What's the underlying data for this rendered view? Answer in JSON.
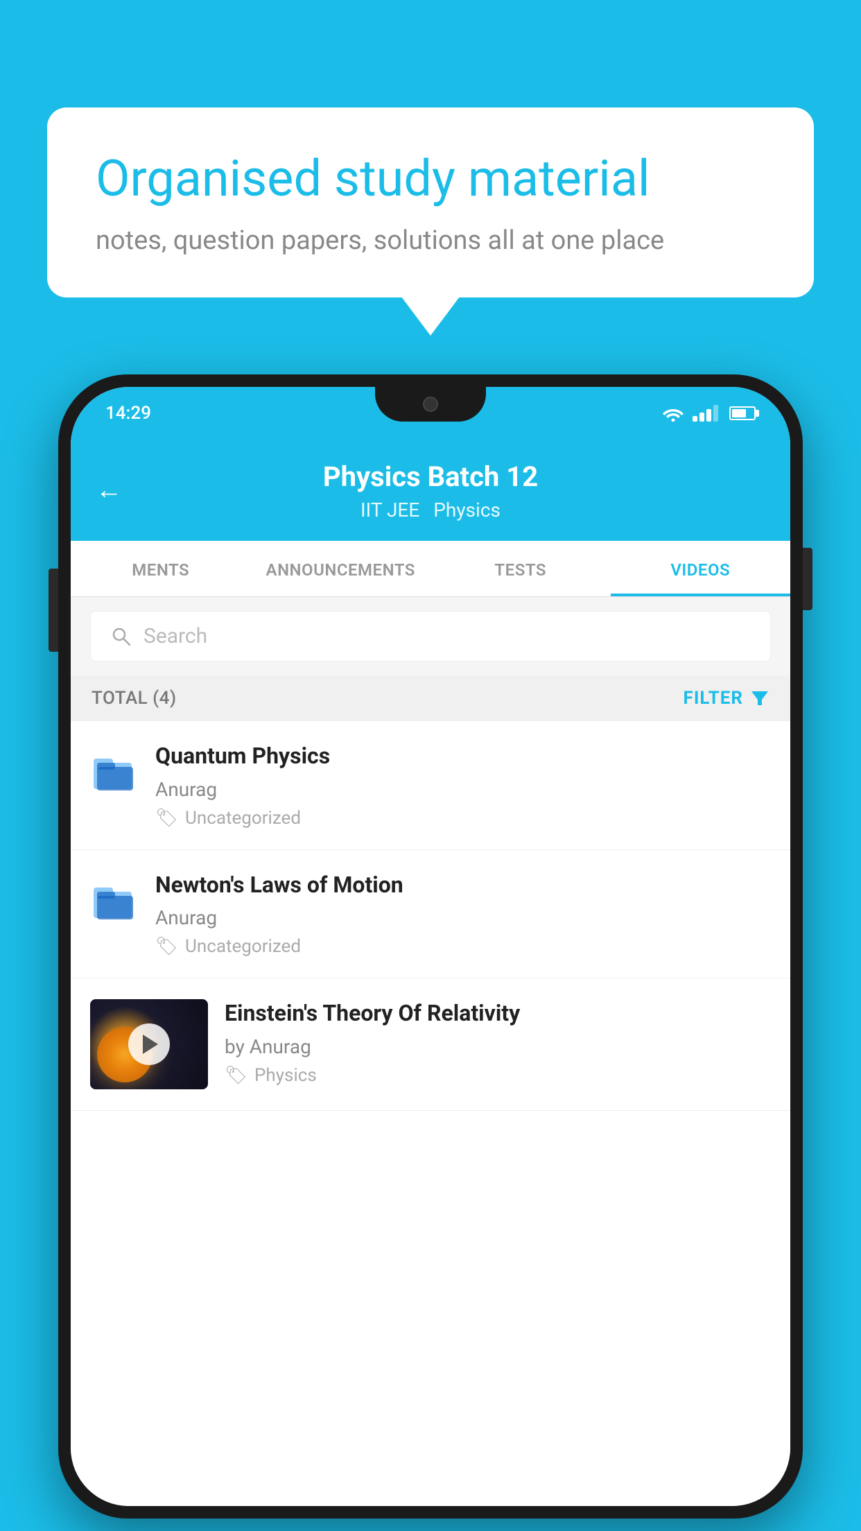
{
  "background": {
    "color": "#1BBDE8"
  },
  "speech_bubble": {
    "title": "Organised study material",
    "subtitle": "notes, question papers, solutions all at one place"
  },
  "phone": {
    "status_bar": {
      "time": "14:29"
    },
    "header": {
      "back_label": "←",
      "title": "Physics Batch 12",
      "subtitle_1": "IIT JEE",
      "subtitle_2": "Physics"
    },
    "tabs": [
      {
        "label": "MENTS",
        "active": false
      },
      {
        "label": "ANNOUNCEMENTS",
        "active": false
      },
      {
        "label": "TESTS",
        "active": false
      },
      {
        "label": "VIDEOS",
        "active": true
      }
    ],
    "search": {
      "placeholder": "Search"
    },
    "filter_bar": {
      "total_label": "TOTAL (4)",
      "filter_label": "FILTER"
    },
    "videos": [
      {
        "id": 1,
        "title": "Quantum Physics",
        "author": "Anurag",
        "tag": "Uncategorized",
        "has_thumbnail": false
      },
      {
        "id": 2,
        "title": "Newton's Laws of Motion",
        "author": "Anurag",
        "tag": "Uncategorized",
        "has_thumbnail": false
      },
      {
        "id": 3,
        "title": "Einstein's Theory Of Relativity",
        "author": "by Anurag",
        "tag": "Physics",
        "has_thumbnail": true
      }
    ]
  }
}
